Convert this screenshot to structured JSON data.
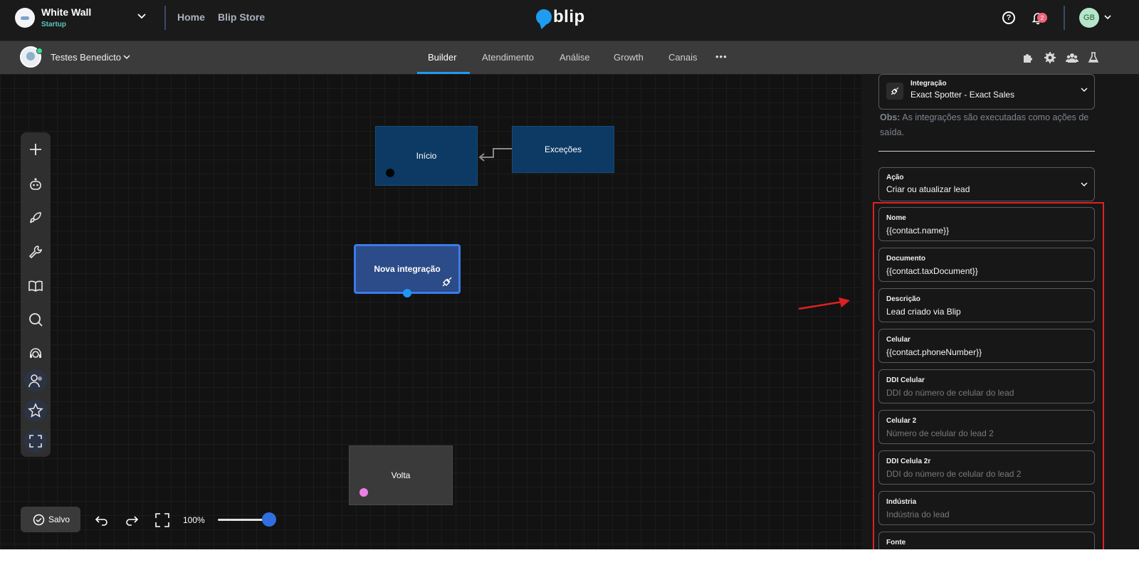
{
  "org": {
    "name": "White Wall",
    "plan": "Startup"
  },
  "nav": {
    "home": "Home",
    "store": "Blip Store"
  },
  "logo_text": "blip",
  "notifications": {
    "count": "2"
  },
  "user": {
    "initials": "GB"
  },
  "bot": {
    "name": "Testes Benedicto"
  },
  "tabs": {
    "builder": "Builder",
    "atendimento": "Atendimento",
    "analise": "Análise",
    "growth": "Growth",
    "canais": "Canais",
    "more": "•••"
  },
  "nodes": {
    "inicio": "Início",
    "excecoes": "Exceções",
    "nova": "Nova integração",
    "volta": "Volta"
  },
  "bottom": {
    "saved": "Salvo",
    "zoom": "100%",
    "zoom_level": 1.0
  },
  "colors": {
    "accent": "#1f9bf0",
    "selected_node": "#3d7ae8",
    "annotation": "#e02020"
  },
  "panel": {
    "integration": {
      "label": "Integração",
      "value": "Exact Spotter - Exact Sales"
    },
    "obs_strong": "Obs:",
    "obs_text": " As integrações são executadas como ações de saída.",
    "action": {
      "label": "Ação",
      "value": "Criar ou atualizar lead"
    },
    "fields": [
      {
        "label": "Nome",
        "value": "{{contact.name}}",
        "placeholder": ""
      },
      {
        "label": "Documento",
        "value": "{{contact.taxDocument}}",
        "placeholder": ""
      },
      {
        "label": "Descrição",
        "value": "Lead criado via Blip",
        "placeholder": ""
      },
      {
        "label": "Celular",
        "value": "{{contact.phoneNumber}}",
        "placeholder": ""
      },
      {
        "label": "DDI Celular",
        "value": "",
        "placeholder": "DDI do número de celular do lead"
      },
      {
        "label": "Celular 2",
        "value": "",
        "placeholder": "Número de celular do lead 2"
      },
      {
        "label": "DDI Celula 2r",
        "value": "",
        "placeholder": "DDI do número de celular do lead 2"
      },
      {
        "label": "Indústria",
        "value": "",
        "placeholder": "Indústria do lead"
      },
      {
        "label": "Fonte",
        "value": "",
        "placeholder": ""
      }
    ]
  }
}
